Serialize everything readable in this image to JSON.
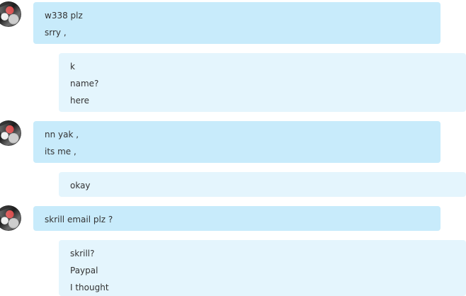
{
  "messages": [
    {
      "direction": "incoming",
      "lines": [
        "w338 plz",
        "srry ,"
      ],
      "avatar_icon": "contact-avatar-icon"
    },
    {
      "direction": "outgoing",
      "lines": [
        "k",
        "name?",
        "here"
      ]
    },
    {
      "direction": "incoming",
      "lines": [
        "nn yak ,",
        "its me ,"
      ],
      "avatar_icon": "contact-avatar-icon"
    },
    {
      "direction": "outgoing",
      "lines": [
        "okay"
      ]
    },
    {
      "direction": "incoming",
      "lines": [
        "skrill email plz ?"
      ],
      "avatar_icon": "contact-avatar-icon"
    },
    {
      "direction": "outgoing",
      "lines": [
        "skrill?",
        "Paypal",
        "I thought"
      ]
    }
  ],
  "colors": {
    "incoming_bubble": "#c8ebfb",
    "outgoing_bubble": "#e4f5fd",
    "text": "#333333"
  }
}
